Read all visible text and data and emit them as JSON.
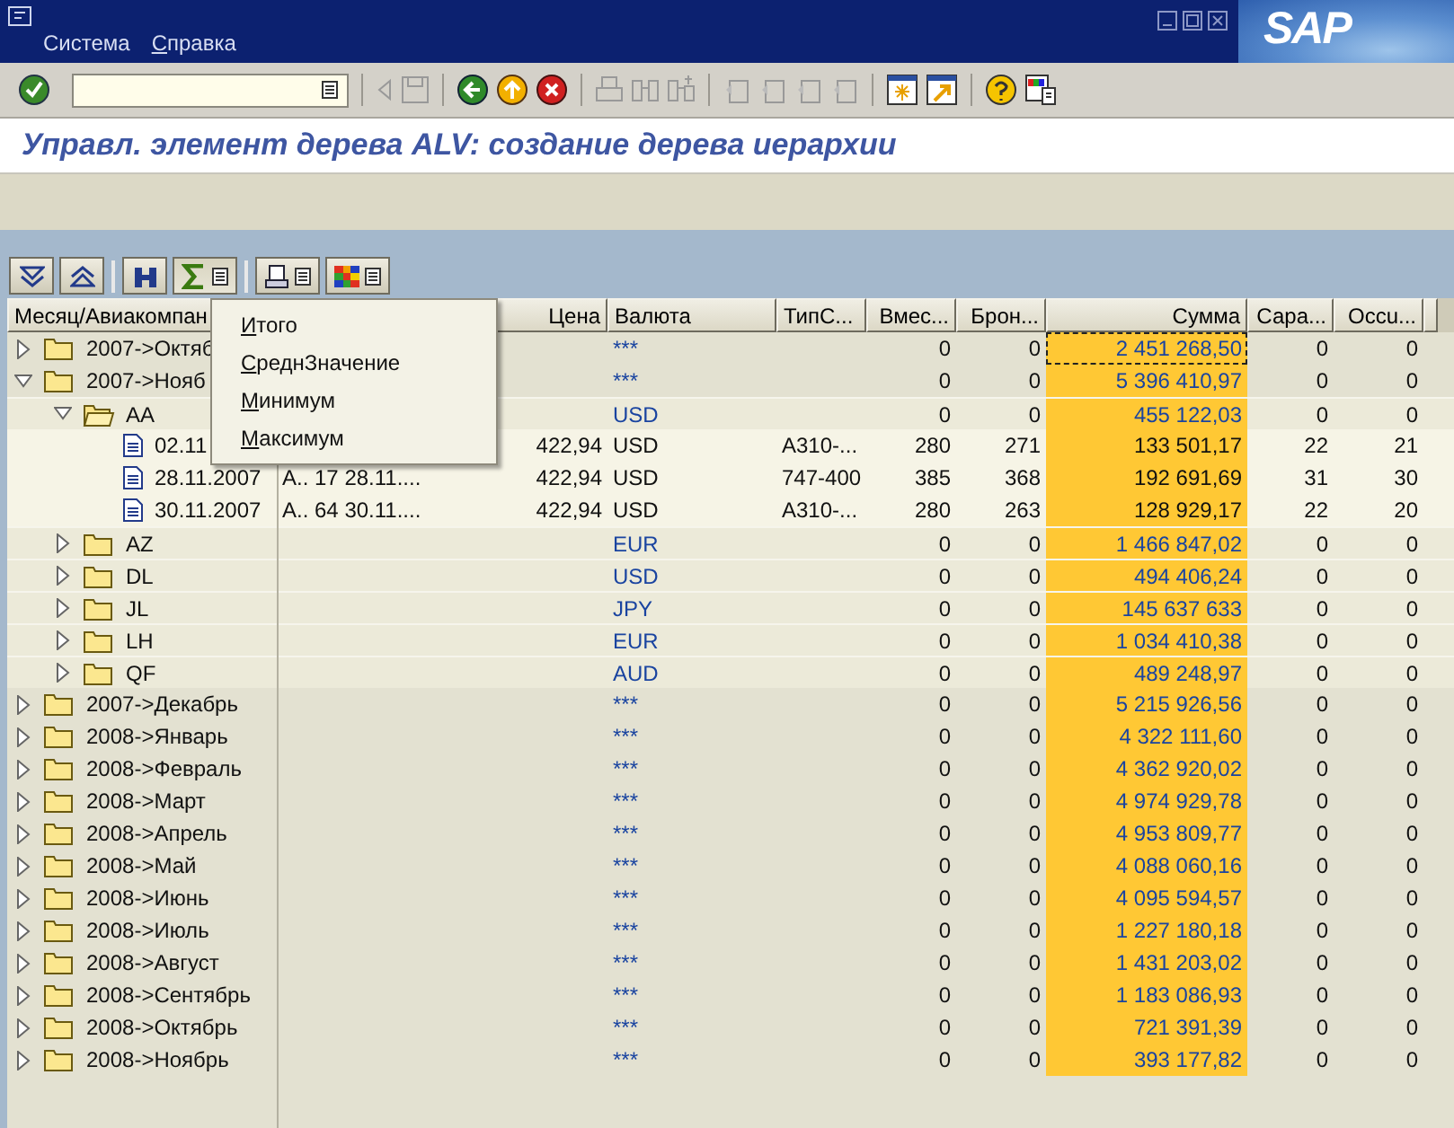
{
  "window": {
    "menu": [
      {
        "label": "Система"
      },
      {
        "label": "Справка"
      }
    ],
    "logo": "SAP"
  },
  "title": "Управл. элемент дерева ALV: создание дерева иерархии",
  "columns": [
    "Месяц/Авиакомпан",
    "Цена",
    "Валюта",
    "ТипС...",
    "Вмес...",
    "Брон...",
    "Сумма",
    "Сара...",
    "Occu..."
  ],
  "rows": [
    {
      "kind": "folder",
      "label": "2007->Октяб",
      "expanded": false,
      "focused": true,
      "currency": "***",
      "seats": "0",
      "booked": "0",
      "sum": "2 451 268,50",
      "capacity": "0",
      "occupied": "0"
    },
    {
      "kind": "folder",
      "label": "2007->Нояб",
      "expanded": true,
      "focused": false,
      "currency": "***",
      "seats": "0",
      "booked": "0",
      "sum": "5 396 410,97",
      "capacity": "0",
      "occupied": "0",
      "children": [
        {
          "kind": "folder",
          "label": "AA",
          "expanded": true,
          "focused": false,
          "currency": "USD",
          "seats": "0",
          "booked": "0",
          "sum": "455 122,03",
          "capacity": "0",
          "occupied": "0",
          "children": [
            {
              "kind": "document",
              "label": "02.11",
              "price": "422,94",
              "currency": "USD",
              "plane_type": "A310-...",
              "seats": "280",
              "booked": "271",
              "sum": "133 501,17",
              "capacity": "22",
              "occupied": "21"
            },
            {
              "kind": "document",
              "label": "28.11.2007",
              "column_2": "A.. 17 28.11....",
              "price": "422,94",
              "currency": "USD",
              "plane_type": "747-400",
              "seats": "385",
              "booked": "368",
              "sum": "192 691,69",
              "capacity": "31",
              "occupied": "30"
            },
            {
              "kind": "document",
              "label": "30.11.2007",
              "column_2": "A.. 64 30.11....",
              "price": "422,94",
              "currency": "USD",
              "plane_type": "A310-...",
              "seats": "280",
              "booked": "263",
              "sum": "128 929,17",
              "capacity": "22",
              "occupied": "20"
            }
          ]
        },
        {
          "kind": "folder",
          "label": "AZ",
          "expanded": false,
          "focused": false,
          "currency": "EUR",
          "seats": "0",
          "booked": "0",
          "sum": "1 466 847,02",
          "capacity": "0",
          "occupied": "0"
        },
        {
          "kind": "folder",
          "label": "DL",
          "expanded": false,
          "focused": false,
          "currency": "USD",
          "seats": "0",
          "booked": "0",
          "sum": "494 406,24",
          "capacity": "0",
          "occupied": "0"
        },
        {
          "kind": "folder",
          "label": "JL",
          "expanded": false,
          "focused": false,
          "currency": "JPY",
          "seats": "0",
          "booked": "0",
          "sum": "145 637 633",
          "capacity": "0",
          "occupied": "0"
        },
        {
          "kind": "folder",
          "label": "LH",
          "expanded": false,
          "focused": false,
          "currency": "EUR",
          "seats": "0",
          "booked": "0",
          "sum": "1 034 410,38",
          "capacity": "0",
          "occupied": "0"
        },
        {
          "kind": "folder",
          "label": "QF",
          "expanded": false,
          "focused": false,
          "currency": "AUD",
          "seats": "0",
          "booked": "0",
          "sum": "489 248,97",
          "capacity": "0",
          "occupied": "0"
        }
      ]
    },
    {
      "kind": "folder",
      "label": "2007->Декабрь",
      "expanded": false,
      "focused": false,
      "currency": "***",
      "seats": "0",
      "booked": "0",
      "sum": "5 215 926,56",
      "capacity": "0",
      "occupied": "0"
    },
    {
      "kind": "folder",
      "label": "2008->Январь",
      "expanded": false,
      "focused": false,
      "currency": "***",
      "seats": "0",
      "booked": "0",
      "sum": "4 322 111,60",
      "capacity": "0",
      "occupied": "0"
    },
    {
      "kind": "folder",
      "label": "2008->Февраль",
      "expanded": false,
      "focused": false,
      "currency": "***",
      "seats": "0",
      "booked": "0",
      "sum": "4 362 920,02",
      "capacity": "0",
      "occupied": "0"
    },
    {
      "kind": "folder",
      "label": "2008->Март",
      "expanded": false,
      "focused": false,
      "currency": "***",
      "seats": "0",
      "booked": "0",
      "sum": "4 974 929,78",
      "capacity": "0",
      "occupied": "0"
    },
    {
      "kind": "folder",
      "label": "2008->Апрель",
      "expanded": false,
      "focused": false,
      "currency": "***",
      "seats": "0",
      "booked": "0",
      "sum": "4 953 809,77",
      "capacity": "0",
      "occupied": "0"
    },
    {
      "kind": "folder",
      "label": "2008->Май",
      "expanded": false,
      "focused": false,
      "currency": "***",
      "seats": "0",
      "booked": "0",
      "sum": "4 088 060,16",
      "capacity": "0",
      "occupied": "0"
    },
    {
      "kind": "folder",
      "label": "2008->Июнь",
      "expanded": false,
      "focused": false,
      "currency": "***",
      "seats": "0",
      "booked": "0",
      "sum": "4 095 594,57",
      "capacity": "0",
      "occupied": "0"
    },
    {
      "kind": "folder",
      "label": "2008->Июль",
      "expanded": false,
      "focused": false,
      "currency": "***",
      "seats": "0",
      "booked": "0",
      "sum": "1 227 180,18",
      "capacity": "0",
      "occupied": "0"
    },
    {
      "kind": "folder",
      "label": "2008->Август",
      "expanded": false,
      "focused": false,
      "currency": "***",
      "seats": "0",
      "booked": "0",
      "sum": "1 431 203,02",
      "capacity": "0",
      "occupied": "0"
    },
    {
      "kind": "folder",
      "label": "2008->Сентябрь",
      "expanded": false,
      "focused": false,
      "currency": "***",
      "seats": "0",
      "booked": "0",
      "sum": "1 183 086,93",
      "capacity": "0",
      "occupied": "0"
    },
    {
      "kind": "folder",
      "label": "2008->Октябрь",
      "expanded": false,
      "focused": false,
      "currency": "***",
      "seats": "0",
      "booked": "0",
      "sum": "721 391,39",
      "capacity": "0",
      "occupied": "0"
    },
    {
      "kind": "folder",
      "label": "2008->Ноябрь",
      "expanded": false,
      "focused": false,
      "currency": "***",
      "seats": "0",
      "booked": "0",
      "sum": "393 177,82",
      "capacity": "0",
      "occupied": "0"
    }
  ],
  "sum_menu": [
    {
      "label": "Итого"
    },
    {
      "label": "СреднЗначение"
    },
    {
      "label": "Минимум"
    },
    {
      "label": "Максимум"
    }
  ]
}
